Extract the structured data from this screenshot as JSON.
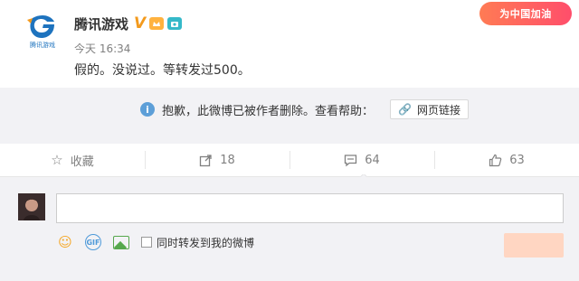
{
  "post": {
    "author": "腾讯游戏",
    "verified_mark": "V",
    "time": "今天 16:34",
    "content": "假的。没说过。等转发过500。",
    "avatar_logo_text": "腾讯游戏"
  },
  "promo": {
    "label": "为中国加油"
  },
  "deleted_notice": {
    "message": "抱歉，此微博已被作者删除。查看帮助：",
    "help_link": "网页链接"
  },
  "actions": {
    "favorite": "收藏",
    "repost": "18",
    "comment": "64",
    "like": "63"
  },
  "comment_box": {
    "input_value": "",
    "also_repost": "同时转发到我的微博",
    "gif_label": "GIF"
  },
  "colors": {
    "accent": "#eb7350",
    "info_blue": "#5d9fd8",
    "verified_orange": "#f39a1d",
    "panel_bg": "#f2f2f5"
  }
}
